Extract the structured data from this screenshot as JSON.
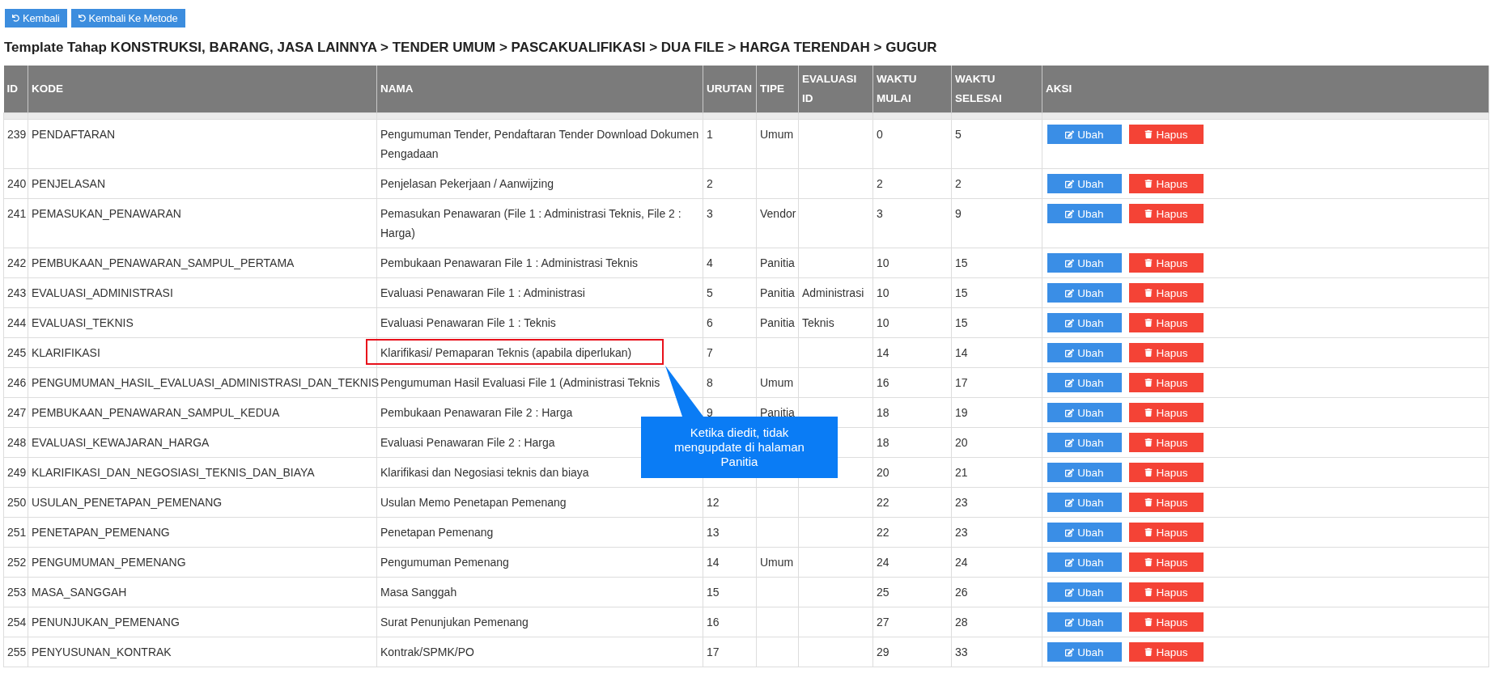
{
  "top_buttons": [
    {
      "label": "Kembali"
    },
    {
      "label": "Kembali Ke Metode"
    }
  ],
  "title": "Template Tahap KONSTRUKSI, BARANG, JASA LAINNYA > TENDER UMUM > PASCAKUALIFIKASI > DUA FILE > HARGA TERENDAH > GUGUR",
  "table": {
    "columns": [
      "ID",
      "KODE",
      "NAMA",
      "URUTAN",
      "TIPE",
      "EVALUASI ID",
      "WAKTU MULAI",
      "WAKTU SELESAI",
      "AKSI"
    ],
    "rows": [
      {
        "id": "239",
        "kode": "PENDAFTARAN",
        "nama": "Pengumuman Tender, Pendaftaran Tender Download Dokumen Pengadaan",
        "urutan": "1",
        "tipe": "Umum",
        "waktu_mulai": "0",
        "waktu_selesai": "5",
        "actions": [
          "Ubah",
          "Hapus"
        ]
      },
      {
        "id": "240",
        "kode": "PENJELASAN",
        "nama": "Penjelasan Pekerjaan / Aanwijzing",
        "urutan": "2",
        "waktu_mulai": "2",
        "waktu_selesai": "2",
        "actions": [
          "Ubah",
          "Hapus"
        ]
      },
      {
        "id": "241",
        "kode": "PEMASUKAN_PENAWARAN",
        "nama": "Pemasukan Penawaran (File 1 : Administrasi Teknis, File 2 : Harga)",
        "urutan": "3",
        "tipe": "Vendor",
        "waktu_mulai": "3",
        "waktu_selesai": "9",
        "actions": [
          "Ubah",
          "Hapus"
        ]
      },
      {
        "id": "242",
        "kode": "PEMBUKAAN_PENAWARAN_SAMPUL_PERTAMA",
        "nama": "Pembukaan Penawaran File 1 : Administrasi Teknis",
        "urutan": "4",
        "tipe": "Panitia",
        "waktu_mulai": "10",
        "waktu_selesai": "15",
        "actions": [
          "Ubah",
          "Hapus"
        ]
      },
      {
        "id": "243",
        "kode": "EVALUASI_ADMINISTRASI",
        "nama": "Evaluasi Penawaran File 1 : Administrasi",
        "urutan": "5",
        "tipe": "Panitia",
        "evaluasi_id": "Administrasi",
        "waktu_mulai": "10",
        "waktu_selesai": "15",
        "actions": [
          "Ubah",
          "Hapus"
        ]
      },
      {
        "id": "244",
        "kode": "EVALUASI_TEKNIS",
        "nama": "Evaluasi Penawaran File 1 : Teknis",
        "urutan": "6",
        "tipe": "Panitia",
        "evaluasi_id": "Teknis",
        "waktu_mulai": "10",
        "waktu_selesai": "15",
        "actions": [
          "Ubah",
          "Hapus"
        ]
      },
      {
        "id": "245",
        "kode": "KLARIFIKASI",
        "nama": "Klarifikasi/ Pemaparan Teknis (apabila diperlukan)",
        "highlighted": true,
        "urutan": "7",
        "waktu_mulai": "14",
        "waktu_selesai": "14",
        "actions": [
          "Ubah",
          "Hapus"
        ]
      },
      {
        "id": "246",
        "kode": "PENGUMUMAN_HASIL_EVALUASI_ADMINISTRASI_DAN_TEKNIS",
        "nama": "Pengumuman Hasil Evaluasi File 1 (Administrasi Teknis",
        "urutan": "8",
        "tipe": "Umum",
        "waktu_mulai": "16",
        "waktu_selesai": "17",
        "actions": [
          "Ubah",
          "Hapus"
        ]
      },
      {
        "id": "247",
        "kode": "PEMBUKAAN_PENAWARAN_SAMPUL_KEDUA",
        "nama": "Pembukaan Penawaran File 2 : Harga",
        "urutan": "9",
        "tipe": "Panitia",
        "waktu_mulai": "18",
        "waktu_selesai": "19",
        "actions": [
          "Ubah",
          "Hapus"
        ]
      },
      {
        "id": "248",
        "kode": "EVALUASI_KEWAJARAN_HARGA",
        "nama": "Evaluasi Penawaran File 2 : Harga",
        "waktu_mulai": "18",
        "waktu_selesai": "20",
        "actions": [
          "Ubah",
          "Hapus"
        ]
      },
      {
        "id": "249",
        "kode": "KLARIFIKASI_DAN_NEGOSIASI_TEKNIS_DAN_BIAYA",
        "nama": "Klarifikasi dan Negosiasi teknis dan biaya",
        "waktu_mulai": "20",
        "waktu_selesai": "21",
        "actions": [
          "Ubah",
          "Hapus"
        ]
      },
      {
        "id": "250",
        "kode": "USULAN_PENETAPAN_PEMENANG",
        "nama": "Usulan Memo Penetapan Pemenang",
        "urutan": "12",
        "waktu_mulai": "22",
        "waktu_selesai": "23",
        "actions": [
          "Ubah",
          "Hapus"
        ]
      },
      {
        "id": "251",
        "kode": "PENETAPAN_PEMENANG",
        "nama": "Penetapan Pemenang",
        "urutan": "13",
        "waktu_mulai": "22",
        "waktu_selesai": "23",
        "actions": [
          "Ubah",
          "Hapus"
        ]
      },
      {
        "id": "252",
        "kode": "PENGUMUMAN_PEMENANG",
        "nama": "Pengumuman Pemenang",
        "urutan": "14",
        "tipe": "Umum",
        "waktu_mulai": "24",
        "waktu_selesai": "24",
        "actions": [
          "Ubah",
          "Hapus"
        ]
      },
      {
        "id": "253",
        "kode": "MASA_SANGGAH",
        "nama": "Masa Sanggah",
        "urutan": "15",
        "waktu_mulai": "25",
        "waktu_selesai": "26",
        "actions": [
          "Ubah",
          "Hapus"
        ]
      },
      {
        "id": "254",
        "kode": "PENUNJUKAN_PEMENANG",
        "nama": "Surat Penunjukan Pemenang",
        "urutan": "16",
        "waktu_mulai": "27",
        "waktu_selesai": "28",
        "actions": [
          "Ubah",
          "Hapus"
        ]
      },
      {
        "id": "255",
        "kode": "PENYUSUNAN_KONTRAK",
        "nama": "Kontrak/SPMK/PO",
        "urutan": "17",
        "waktu_mulai": "29",
        "waktu_selesai": "33",
        "actions": [
          "Ubah",
          "Hapus"
        ]
      }
    ]
  },
  "annotation": {
    "callout": "Ketika diedit, tidak mengupdate di halaman Panitia"
  }
}
